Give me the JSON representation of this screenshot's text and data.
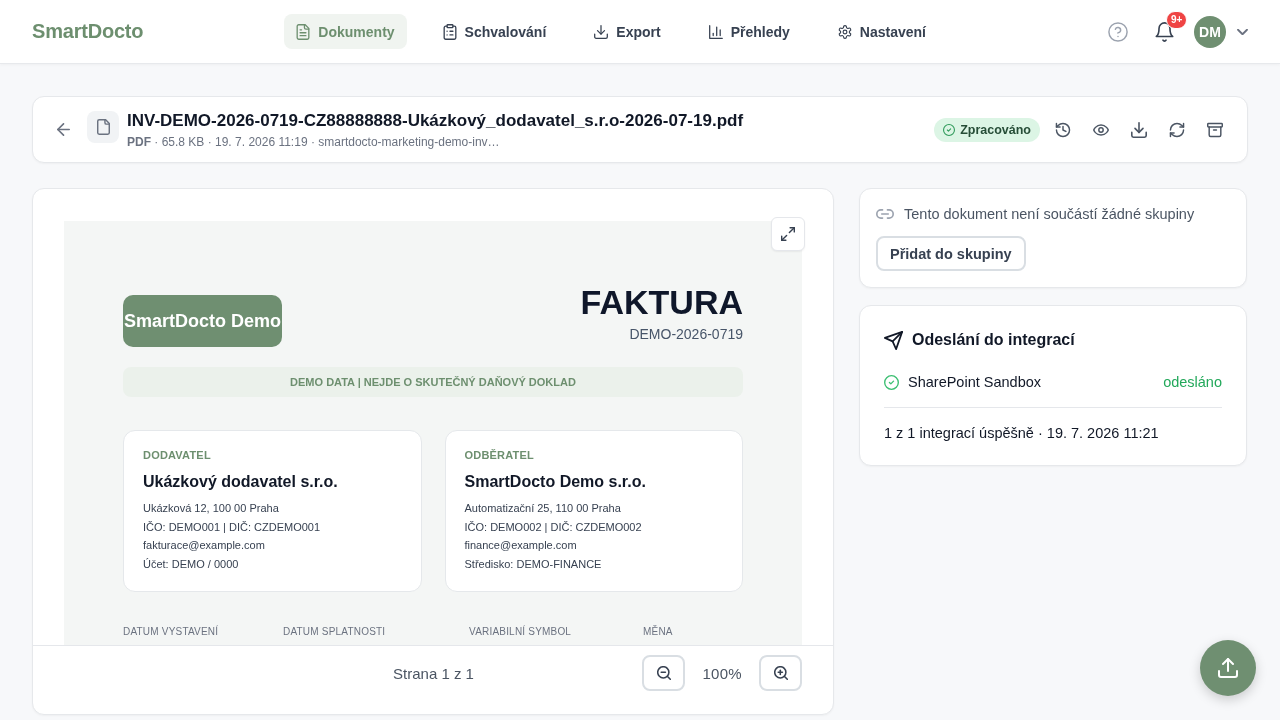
{
  "header": {
    "logo": "SmartDocto",
    "nav": [
      {
        "label": "Dokumenty",
        "selected": true
      },
      {
        "label": "Schvalování",
        "selected": false
      },
      {
        "label": "Export",
        "selected": false
      },
      {
        "label": "Přehledy",
        "selected": false
      },
      {
        "label": "Nastavení",
        "selected": false
      }
    ],
    "notification_badge": "9+",
    "avatar": "DM"
  },
  "document": {
    "file_name": "INV-DEMO-2026-0719-CZ88888888-Ukázkový_dodavatel_s.r.o-2026-07-19.pdf",
    "meta": "**PDF** · 65.8 KB · 19. 7. 2026 11:19 · smartdocto-marketing-demo-inv…",
    "status": {
      "label": "Zpracováno",
      "kind": "success"
    }
  },
  "preview": {
    "invoice": {
      "logo": "SmartDocto Demo",
      "title": "FAKTURA",
      "number": "DEMO-2026-0719",
      "banner": "DEMO DATA | NEJDE O SKUTEČNÝ DAŇOVÝ DOKLAD",
      "parties": [
        {
          "label": "DODAVATEL",
          "name": "Ukázkový dodavatel s.r.o.",
          "lines": [
            "Ukázková 12, 100 00 Praha",
            "IČO: DEMO001 | DIČ: CZDEMO001",
            "fakturace@example.com",
            "Účet: DEMO / 0000"
          ]
        },
        {
          "label": "ODBĚRATEL",
          "name": "SmartDocto Demo s.r.o.",
          "lines": [
            "Automatizační 25, 110 00 Praha",
            "IČO: DEMO002 | DIČ: CZDEMO002",
            "finance@example.com",
            "Středisko: DEMO-FINANCE"
          ]
        }
      ],
      "fields": [
        "DATUM VYSTAVENÍ",
        "DATUM SPLATNOSTI",
        "VARIABILNÍ SYMBOL",
        "MĚNA"
      ]
    },
    "page": "Strana 1 z 1",
    "zoom": "100%"
  },
  "group": {
    "text": "Tento dokument není součástí žádné skupiny",
    "button": "Přidat do skupiny"
  },
  "integrations": {
    "title": "Odeslání do integrací",
    "items": [
      {
        "name": "SharePoint Sandbox",
        "status": "odesláno",
        "succeeded": true
      }
    ],
    "summary": "1 z 1 integrací úspěšně · 19. 7. 2026 11:21"
  }
}
